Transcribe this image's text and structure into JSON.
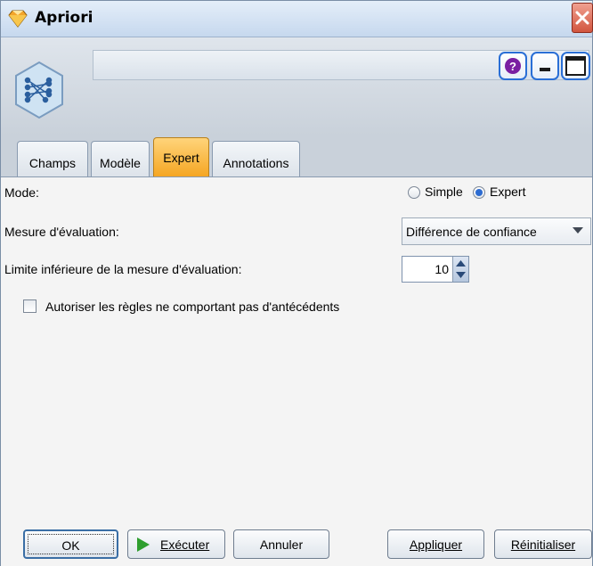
{
  "window": {
    "title": "Apriori",
    "node_icon": "apriori-node-icon",
    "close_icon": "close-icon"
  },
  "header": {
    "buttons": [
      {
        "name": "help-icon",
        "label": "?"
      },
      {
        "name": "minimize-icon",
        "label": ""
      },
      {
        "name": "maximize-icon",
        "label": ""
      }
    ]
  },
  "tabs": [
    {
      "label": "Champs",
      "active": false
    },
    {
      "label": "Modèle",
      "active": false
    },
    {
      "label": "Expert",
      "active": true
    },
    {
      "label": "Annotations",
      "active": false
    }
  ],
  "form": {
    "mode_label": "Mode:",
    "mode_options": [
      {
        "label": "Simple",
        "selected": false
      },
      {
        "label": "Expert",
        "selected": true
      }
    ],
    "measure_label": "Mesure d'évaluation:",
    "measure_value": "Différence de confiance",
    "lower_limit_label": "Limite inférieure de la mesure d'évaluation:",
    "lower_limit_value": "10",
    "allow_rules_label": "Autoriser les règles ne comportant pas d'antécédents",
    "allow_rules_checked": false
  },
  "footer": {
    "ok": "OK",
    "run": "Exécuter",
    "cancel": "Annuler",
    "apply": "Appliquer",
    "reset": "Réinitialiser"
  },
  "colors": {
    "active_tab": "#f5a623",
    "help_icon": "#7a1fa2",
    "run_icon": "#2e9e2e",
    "selected_radio": "#2c6bd1"
  }
}
